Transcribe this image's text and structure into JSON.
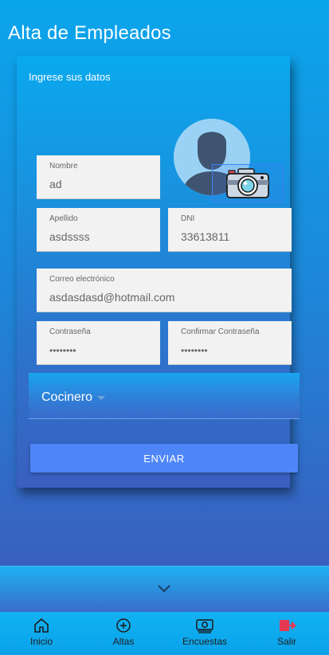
{
  "header": {
    "title": "Alta de Empleados"
  },
  "form": {
    "subtitle": "Ingrese sus datos",
    "fields": {
      "nombre": {
        "label": "Nombre",
        "value": "ad"
      },
      "apellido": {
        "label": "Apellido",
        "value": "asdssss"
      },
      "dni": {
        "label": "DNI",
        "value": "33613811"
      },
      "correo": {
        "label": "Correo electrónico",
        "value": "asdasdasd@hotmail.com"
      },
      "password": {
        "label": "Contraseña",
        "value": "••••••••"
      },
      "confirm": {
        "label": "Confirmar Contraseña",
        "value": "••••••••"
      }
    },
    "role_select": {
      "value": "Cocinero"
    },
    "submit_label": "ENVIAR"
  },
  "tabs": [
    {
      "label": "Inicio",
      "icon": "home-icon"
    },
    {
      "label": "Altas",
      "icon": "add-circle-icon"
    },
    {
      "label": "Encuestas",
      "icon": "money-icon"
    },
    {
      "label": "Salir",
      "icon": "logout-icon"
    }
  ],
  "colors": {
    "primary": "#0aa6ec",
    "button": "#4f86f7",
    "exit_icon": "#e53952"
  }
}
